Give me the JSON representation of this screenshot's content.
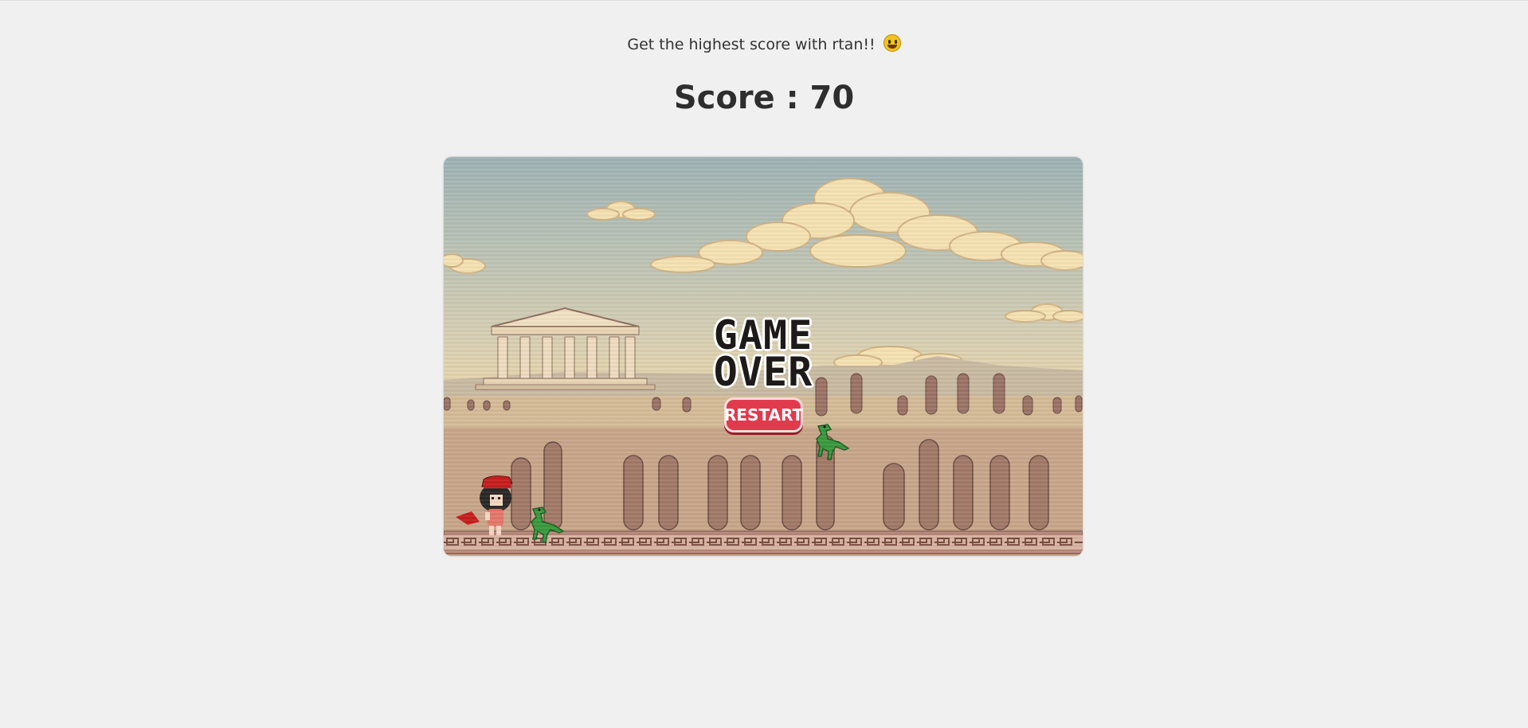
{
  "header": {
    "tagline": "Get the highest score with rtan!!",
    "tagline_emoji": "grinning-face-emoji",
    "score_text": "Score : 70"
  },
  "game": {
    "title_line1": "GAME",
    "title_line2": "OVER",
    "restart_label": "RESTART",
    "colors": {
      "restart_button": "#e23a4d",
      "title_text": "#1e1a19",
      "dinosaur": "#3a9a3e",
      "helmet": "#c61e1e"
    }
  }
}
